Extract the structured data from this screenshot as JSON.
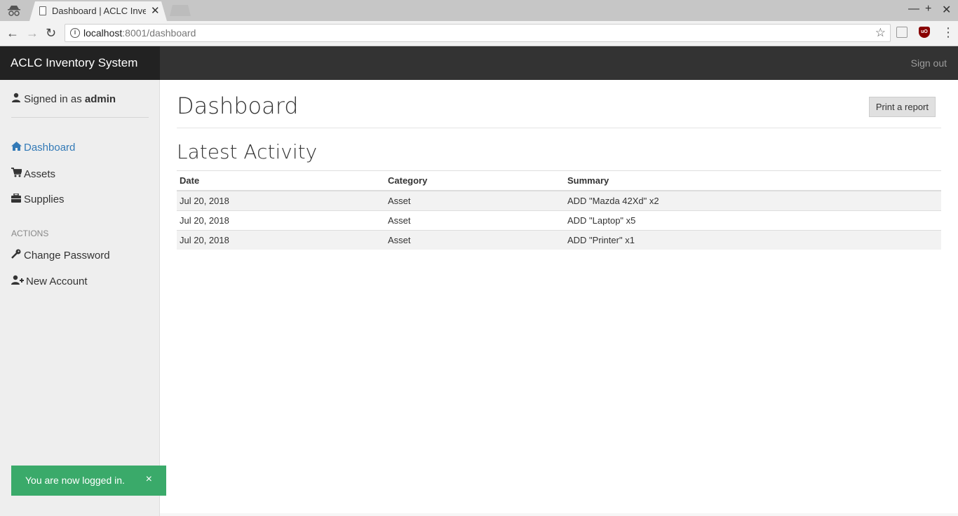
{
  "browser": {
    "tab_title": "Dashboard | ACLC Inventory System",
    "url_host": "localhost",
    "url_path": ":8001/dashboard",
    "window_controls": [
      "—",
      "+",
      "✕"
    ]
  },
  "app": {
    "brand": "ACLC Inventory System",
    "sign_out": "Sign out"
  },
  "sidebar": {
    "signed_in_prefix": "Signed in as",
    "username": "admin",
    "nav": [
      {
        "label": "Dashboard",
        "icon": "home-icon"
      },
      {
        "label": "Assets",
        "icon": "cart-icon"
      },
      {
        "label": "Supplies",
        "icon": "briefcase-icon"
      }
    ],
    "actions_label": "ACTIONS",
    "actions": [
      {
        "label": "Change Password",
        "icon": "key-icon"
      },
      {
        "label": "New Account",
        "icon": "user-plus-icon"
      }
    ]
  },
  "main": {
    "title": "Dashboard",
    "print_button": "Print a report",
    "section_title": "Latest Activity",
    "table": {
      "headers": [
        "Date",
        "Category",
        "Summary"
      ],
      "rows": [
        [
          "Jul 20, 2018",
          "Asset",
          "ADD \"Mazda 42Xd\" x2"
        ],
        [
          "Jul 20, 2018",
          "Asset",
          "ADD \"Laptop\" x5"
        ],
        [
          "Jul 20, 2018",
          "Asset",
          "ADD \"Printer\" x1"
        ]
      ]
    }
  },
  "toast": {
    "message": "You are now logged in.",
    "close": "×",
    "color": "#3aaa6a"
  }
}
